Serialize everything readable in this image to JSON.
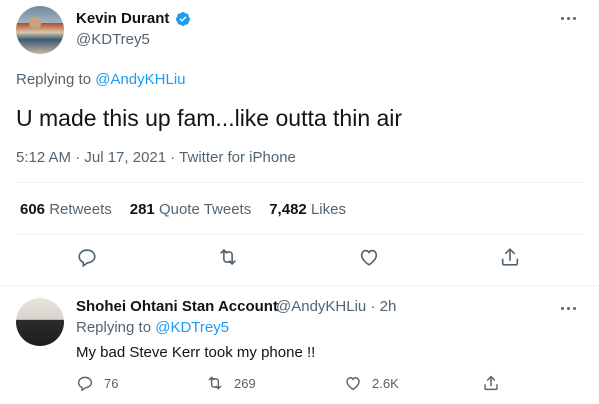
{
  "tweet": {
    "author_name": "Kevin Durant",
    "handle": "@KDTrey5",
    "replying_prefix": "Replying to ",
    "replying_handle": "@AndyKHLiu",
    "text": "U made this up fam...like outta thin air",
    "meta": "5:12 AM · Jul 17, 2021 · Twitter for iPhone",
    "stats": {
      "retweets_count": "606",
      "retweets_label": "Retweets",
      "quotes_count": "281",
      "quotes_label": "Quote Tweets",
      "likes_count": "7,482",
      "likes_label": "Likes"
    },
    "icons": [
      "reply-icon",
      "retweet-icon",
      "like-icon",
      "share-icon"
    ],
    "verified_color": "#1d9bf0"
  },
  "reply": {
    "author_name": "Shohei Ohtani Stan Account",
    "handle_time": "@AndyKHLiu · 2h",
    "replying_prefix": "Replying to ",
    "replying_handle": "@KDTrey5",
    "text": "My bad Steve Kerr took my phone !!",
    "counts": {
      "replies": "76",
      "retweets": "269",
      "likes": "2.6K"
    }
  },
  "colors": {
    "link": "#1d9bf0",
    "secondary_text": "#536471",
    "primary_text": "#0f1419",
    "divider": "#eff3f4"
  }
}
